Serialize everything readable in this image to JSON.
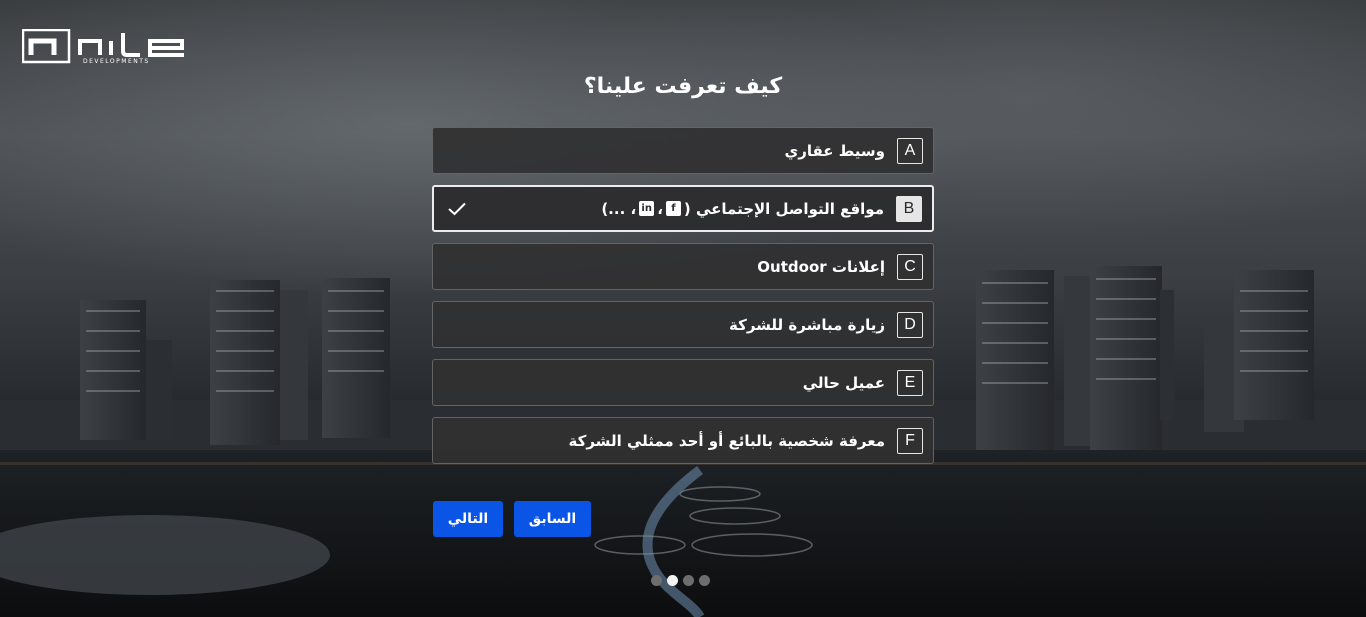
{
  "brand": {
    "name": "nile",
    "tagline": "DEVELOPMENTS"
  },
  "question": {
    "title": "كيف تعرفت علينا؟"
  },
  "options": [
    {
      "key": "A",
      "label": "وسيط عقاري",
      "selected": false
    },
    {
      "key": "B",
      "label": "مواقع التواصل الإجتماعي (",
      "suffix": "، ...)",
      "selected": true,
      "icons": [
        "facebook-icon",
        "linkedin-icon"
      ]
    },
    {
      "key": "C",
      "label": "إعلانات Outdoor",
      "selected": false
    },
    {
      "key": "D",
      "label": "زيارة مباشرة للشركة",
      "selected": false
    },
    {
      "key": "E",
      "label": "عميل حالي",
      "selected": false
    },
    {
      "key": "F",
      "label": "معرفة شخصية بالبائع أو أحد ممثلي الشركة",
      "selected": false
    }
  ],
  "buttons": {
    "next_label": "التالي",
    "prev_label": "السابق"
  },
  "pagination": {
    "total": 4,
    "current": 2
  },
  "colors": {
    "accent": "#0a55e6",
    "option_bg": "#303032",
    "selected_border": "#ececec"
  }
}
